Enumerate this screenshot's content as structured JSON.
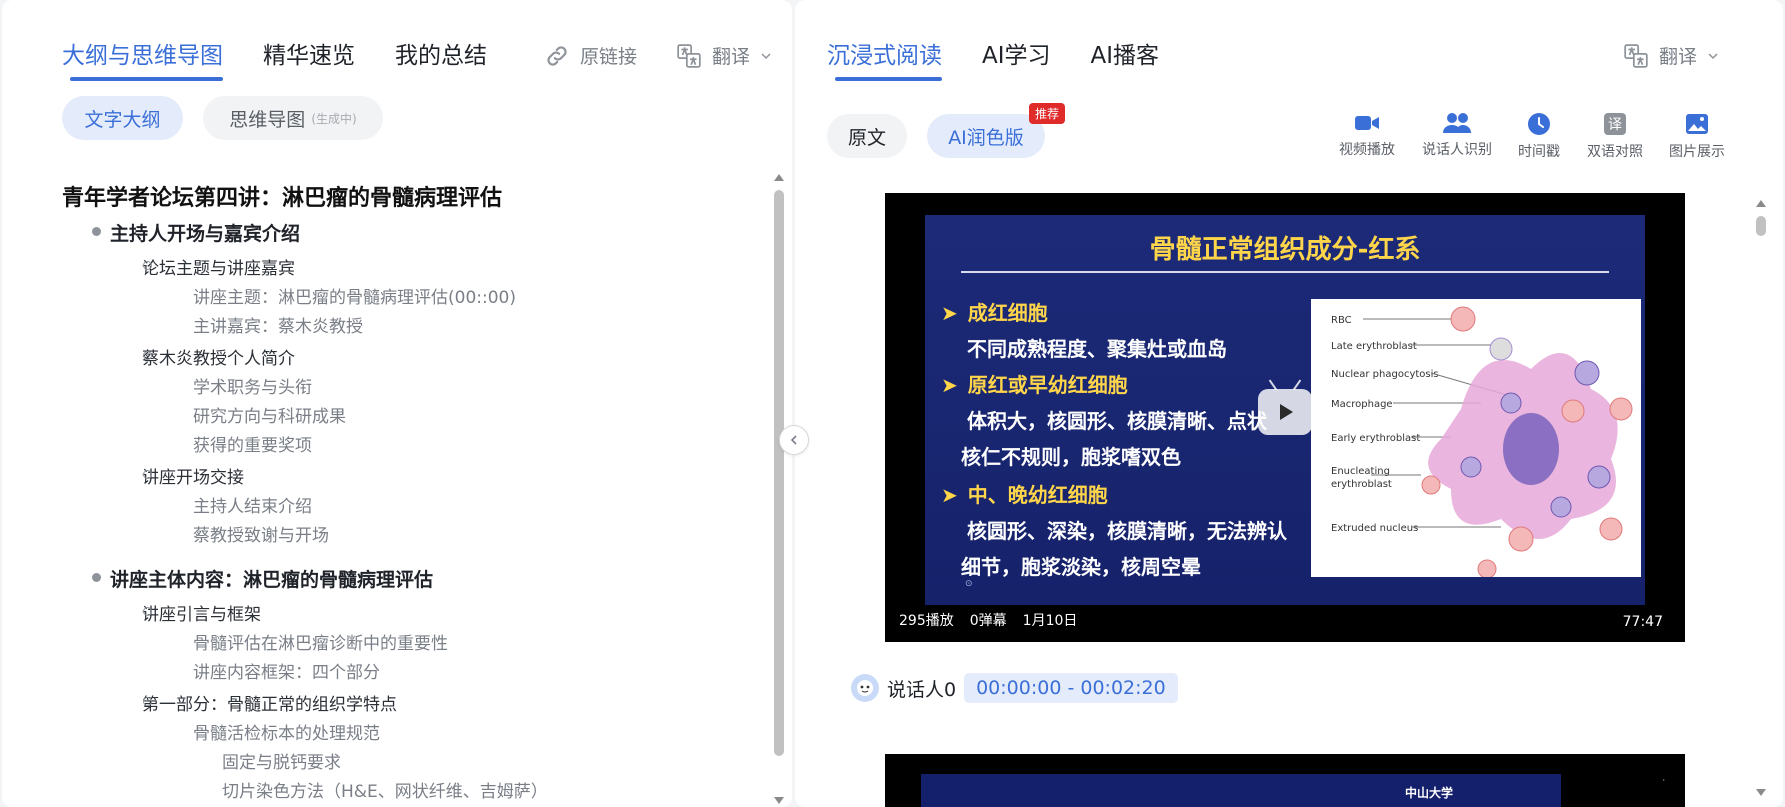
{
  "left": {
    "tabs": [
      {
        "label": "大纲与思维导图",
        "active": true
      },
      {
        "label": "精华速览",
        "active": false
      },
      {
        "label": "我的总结",
        "active": false
      }
    ],
    "original_link_label": "原链接",
    "translate_label": "翻译",
    "view_toggle": {
      "outline_label": "文字大纲",
      "mindmap_label": "思维导图",
      "mindmap_status": "(生成中)"
    },
    "outline": {
      "title": "青年学者论坛第四讲：淋巴瘤的骨髓病理评估",
      "items": [
        {
          "level": 1,
          "text": "主持人开场与嘉宾介绍"
        },
        {
          "level": 2,
          "text": "论坛主题与讲座嘉宾"
        },
        {
          "level": 3,
          "text": "讲座主题：淋巴瘤的骨髓病理评估(00::00)"
        },
        {
          "level": 3,
          "text": "主讲嘉宾：蔡木炎教授"
        },
        {
          "level": 2,
          "text": "蔡木炎教授个人简介"
        },
        {
          "level": 3,
          "text": "学术职务与头衔"
        },
        {
          "level": 3,
          "text": "研究方向与科研成果"
        },
        {
          "level": 3,
          "text": "获得的重要奖项"
        },
        {
          "level": 2,
          "text": "讲座开场交接"
        },
        {
          "level": 3,
          "text": "主持人结束介绍"
        },
        {
          "level": 3,
          "text": "蔡教授致谢与开场"
        },
        {
          "level": 1,
          "text": "讲座主体内容：淋巴瘤的骨髓病理评估"
        },
        {
          "level": 2,
          "text": "讲座引言与框架"
        },
        {
          "level": 3,
          "text": "骨髓评估在淋巴瘤诊断中的重要性"
        },
        {
          "level": 3,
          "text": "讲座内容框架：四个部分"
        },
        {
          "level": 2,
          "text": "第一部分：骨髓正常的组织学特点"
        },
        {
          "level": 3,
          "text": "骨髓活检标本的处理规范"
        },
        {
          "level": 4,
          "text": "固定与脱钙要求"
        },
        {
          "level": 4,
          "text": "切片染色方法（H&E、网状纤维、吉姆萨）"
        }
      ]
    }
  },
  "right": {
    "tabs": [
      {
        "label": "沉浸式阅读",
        "active": true
      },
      {
        "label": "AI学习",
        "active": false
      },
      {
        "label": "AI播客",
        "active": false
      }
    ],
    "translate_label": "翻译",
    "version_toggle": {
      "original_label": "原文",
      "ai_label": "AI润色版",
      "ai_badge": "推荐"
    },
    "tools": [
      {
        "icon": "video-camera-icon",
        "label": "视频播放"
      },
      {
        "icon": "speakers-icon",
        "label": "说话人识别"
      },
      {
        "icon": "clock-icon",
        "label": "时间戳"
      },
      {
        "icon": "translate-icon",
        "label": "双语对照"
      },
      {
        "icon": "image-icon",
        "label": "图片展示"
      }
    ],
    "video": {
      "slide_title": "骨髓正常组织成分-红系",
      "slide_lines": [
        {
          "head": true,
          "text": "成红细胞"
        },
        {
          "head": false,
          "text": "不同成熟程度、聚集灶或血岛"
        },
        {
          "head": true,
          "text": "原红或早幼红细胞"
        },
        {
          "head": false,
          "text": "体积大，核圆形、核膜清晰、点状"
        },
        {
          "head": false,
          "text": "核仁不规则，胞浆嗜双色"
        },
        {
          "head": true,
          "text": "中、晚幼红细胞"
        },
        {
          "head": false,
          "text": "核圆形、深染，核膜清晰，无法辨认"
        },
        {
          "head": false,
          "text": "细节，胞浆淡染，核周空晕"
        }
      ],
      "figure_labels": [
        "RBC",
        "Late erythroblast",
        "Nuclear phagocytosis",
        "Macrophage",
        "Early erythroblast",
        "Enucleating erythroblast",
        "Extruded nucleus"
      ],
      "plays": "295播放",
      "danmaku": "0弹幕",
      "date": "1月10日",
      "duration": "77:47"
    },
    "speaker": {
      "name": "说话人0",
      "time_range": "00:00:00 - 00:02:20"
    }
  },
  "colors": {
    "accent": "#3b6fd8",
    "accent_bg": "#e4ecfb",
    "badge": "#e02b2b"
  }
}
